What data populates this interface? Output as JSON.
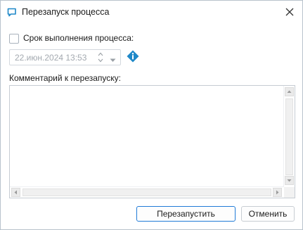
{
  "window": {
    "title": "Перезапуск процесса"
  },
  "deadline": {
    "checkbox_label": "Срок выполнения процесса:",
    "checked": false,
    "date_value": "22.июн.2024 13:53"
  },
  "comment": {
    "label": "Комментарий к перезапуску:",
    "value": ""
  },
  "buttons": {
    "restart": "Перезапустить",
    "cancel": "Отменить"
  },
  "colors": {
    "accent": "#1f7ad6",
    "info_icon": "#1e88c8",
    "title_icon": "#1e88c8"
  },
  "icons": [
    "restart-icon",
    "close-icon",
    "calendar-spin-icon",
    "chevron-down-icon",
    "info-icon"
  ]
}
